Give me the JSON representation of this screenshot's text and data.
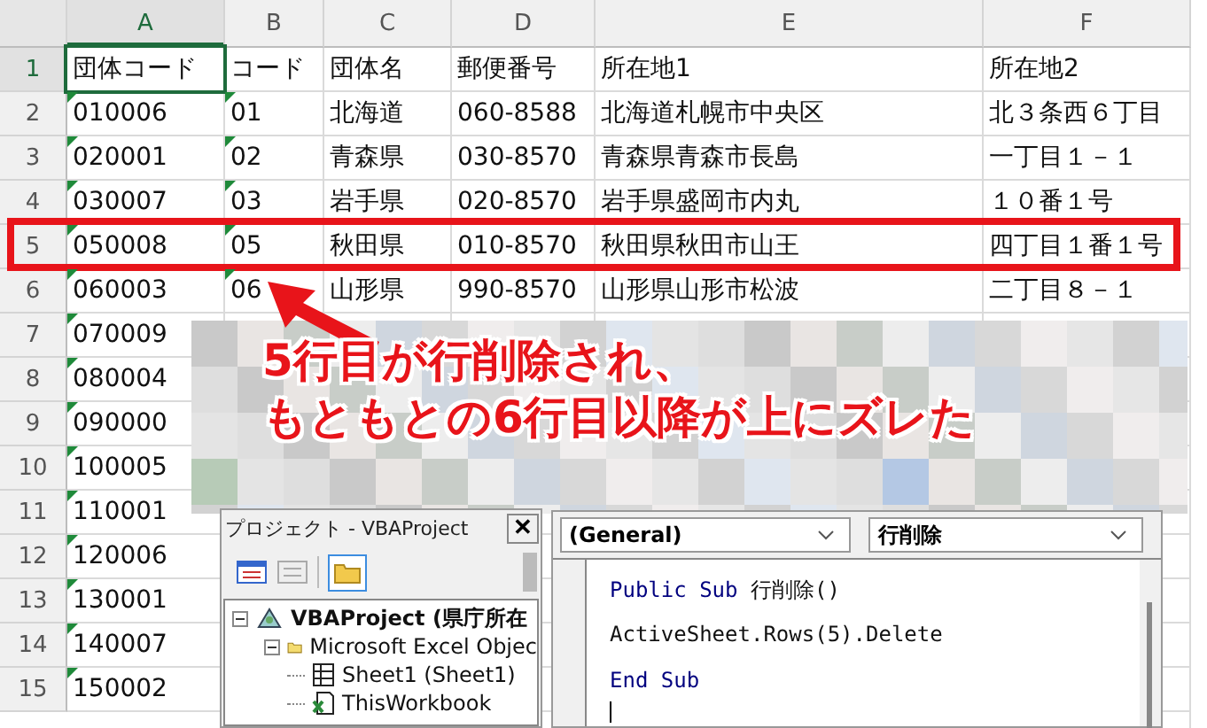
{
  "columns": [
    {
      "label": "A",
      "selected": true
    },
    {
      "label": "B",
      "selected": false
    },
    {
      "label": "C",
      "selected": false
    },
    {
      "label": "D",
      "selected": false
    },
    {
      "label": "E",
      "selected": false
    },
    {
      "label": "F",
      "selected": false
    }
  ],
  "rows": [
    {
      "number": "1",
      "selected": true,
      "highlighted": false,
      "cells": [
        {
          "text": "団体コード",
          "selected": true,
          "flag": false
        },
        {
          "text": "コード",
          "selected": false,
          "flag": false
        },
        {
          "text": "団体名",
          "selected": false,
          "flag": false
        },
        {
          "text": "郵便番号",
          "selected": false,
          "flag": false
        },
        {
          "text": "所在地1",
          "selected": false,
          "flag": false
        },
        {
          "text": "所在地2",
          "selected": false,
          "flag": false
        }
      ]
    },
    {
      "number": "2",
      "selected": false,
      "highlighted": false,
      "cells": [
        {
          "text": "010006",
          "selected": false,
          "flag": true
        },
        {
          "text": "01",
          "selected": false,
          "flag": true
        },
        {
          "text": "北海道",
          "selected": false,
          "flag": false
        },
        {
          "text": "060-8588",
          "selected": false,
          "flag": false
        },
        {
          "text": "北海道札幌市中央区",
          "selected": false,
          "flag": false
        },
        {
          "text": "北３条西６丁目",
          "selected": false,
          "flag": false
        }
      ]
    },
    {
      "number": "3",
      "selected": false,
      "highlighted": false,
      "cells": [
        {
          "text": "020001",
          "selected": false,
          "flag": true
        },
        {
          "text": "02",
          "selected": false,
          "flag": true
        },
        {
          "text": "青森県",
          "selected": false,
          "flag": false
        },
        {
          "text": "030-8570",
          "selected": false,
          "flag": false
        },
        {
          "text": "青森県青森市長島",
          "selected": false,
          "flag": false
        },
        {
          "text": "一丁目１－１",
          "selected": false,
          "flag": false
        }
      ]
    },
    {
      "number": "4",
      "selected": false,
      "highlighted": false,
      "cells": [
        {
          "text": "030007",
          "selected": false,
          "flag": true
        },
        {
          "text": "03",
          "selected": false,
          "flag": true
        },
        {
          "text": "岩手県",
          "selected": false,
          "flag": false
        },
        {
          "text": "020-8570",
          "selected": false,
          "flag": false
        },
        {
          "text": "岩手県盛岡市内丸",
          "selected": false,
          "flag": false
        },
        {
          "text": "１０番１号",
          "selected": false,
          "flag": false
        }
      ]
    },
    {
      "number": "5",
      "selected": false,
      "highlighted": true,
      "cells": [
        {
          "text": "050008",
          "selected": false,
          "flag": true
        },
        {
          "text": "05",
          "selected": false,
          "flag": true
        },
        {
          "text": "秋田県",
          "selected": false,
          "flag": false
        },
        {
          "text": "010-8570",
          "selected": false,
          "flag": false
        },
        {
          "text": "秋田県秋田市山王",
          "selected": false,
          "flag": false
        },
        {
          "text": "四丁目１番１号",
          "selected": false,
          "flag": false
        }
      ]
    },
    {
      "number": "6",
      "selected": false,
      "highlighted": false,
      "cells": [
        {
          "text": "060003",
          "selected": false,
          "flag": true
        },
        {
          "text": "06",
          "selected": false,
          "flag": true
        },
        {
          "text": "山形県",
          "selected": false,
          "flag": false
        },
        {
          "text": "990-8570",
          "selected": false,
          "flag": false
        },
        {
          "text": "山形県山形市松波",
          "selected": false,
          "flag": false
        },
        {
          "text": "二丁目８－１",
          "selected": false,
          "flag": false
        }
      ]
    },
    {
      "number": "7",
      "selected": false,
      "highlighted": false,
      "cells": [
        {
          "text": "070009",
          "selected": false,
          "flag": true
        }
      ]
    },
    {
      "number": "8",
      "selected": false,
      "highlighted": false,
      "cells": [
        {
          "text": "080004",
          "selected": false,
          "flag": true
        }
      ]
    },
    {
      "number": "9",
      "selected": false,
      "highlighted": false,
      "cells": [
        {
          "text": "090000",
          "selected": false,
          "flag": true
        }
      ]
    },
    {
      "number": "10",
      "selected": false,
      "highlighted": false,
      "cells": [
        {
          "text": "100005",
          "selected": false,
          "flag": true
        }
      ]
    },
    {
      "number": "11",
      "selected": false,
      "highlighted": false,
      "cells": [
        {
          "text": "110001",
          "selected": false,
          "flag": true
        }
      ]
    },
    {
      "number": "12",
      "selected": false,
      "highlighted": false,
      "cells": [
        {
          "text": "120006",
          "selected": false,
          "flag": true
        }
      ]
    },
    {
      "number": "13",
      "selected": false,
      "highlighted": false,
      "cells": [
        {
          "text": "130001",
          "selected": false,
          "flag": true
        }
      ]
    },
    {
      "number": "14",
      "selected": false,
      "highlighted": false,
      "cells": [
        {
          "text": "140007",
          "selected": false,
          "flag": true
        }
      ]
    },
    {
      "number": "15",
      "selected": false,
      "highlighted": false,
      "cells": [
        {
          "text": "150002",
          "selected": false,
          "flag": true
        }
      ]
    }
  ],
  "callout": {
    "lines": [
      "5行目が行削除され、",
      "もともとの6行目以降が上にズレた"
    ]
  },
  "project_window": {
    "title": "プロジェクト - VBAProject",
    "close": "✕",
    "tree": [
      {
        "label": "VBAProject (県庁所在",
        "kind": "project",
        "expanded": true,
        "children": [
          {
            "label": "Microsoft Excel Objec",
            "kind": "folder",
            "expanded": true,
            "children": [
              {
                "label": "Sheet1 (Sheet1)",
                "kind": "sheet"
              },
              {
                "label": "ThisWorkbook",
                "kind": "workbook"
              }
            ]
          }
        ]
      }
    ]
  },
  "code_window": {
    "object_select": "(General)",
    "procedure_select": "行削除",
    "lines": [
      [
        {
          "text": "Public Sub",
          "kind": "keyword"
        },
        {
          "text": " 行削除()",
          "kind": "plain"
        }
      ],
      [
        {
          "text": "ActiveSheet.Rows(5).Delete",
          "kind": "plain"
        }
      ],
      [
        {
          "text": "End Sub",
          "kind": "keyword"
        }
      ]
    ]
  }
}
